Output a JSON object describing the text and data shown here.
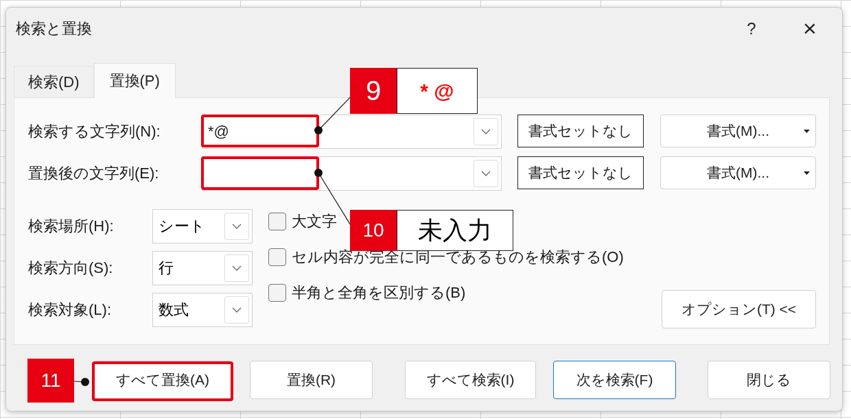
{
  "window": {
    "title": "検索と置換",
    "help": "?",
    "close": "×"
  },
  "tabs": [
    {
      "label": "検索(D)",
      "selected": false
    },
    {
      "label": "置換(P)",
      "selected": true
    }
  ],
  "fields": [
    {
      "label": "検索する文字列(N):",
      "value": "*@",
      "format_preview": "書式セットなし",
      "format_button": "書式(M)..."
    },
    {
      "label": "置換後の文字列(E):",
      "format_preview": "書式セットなし",
      "format_button": "書式(M)..."
    }
  ],
  "selects": [
    {
      "label": "検索場所(H):",
      "value": "シート"
    },
    {
      "label": "検索方向(S):",
      "value": "行"
    },
    {
      "label": "検索対象(L):",
      "value": "数式"
    }
  ],
  "checkboxes": [
    {
      "label": "大文字",
      "checked": false
    },
    {
      "label": "セル内容が完全に同一であるものを検索する(O)",
      "checked": false
    },
    {
      "label": "半角と全角を区別する(B)",
      "checked": false
    }
  ],
  "options_button": "オプション(T) <<",
  "buttons": [
    {
      "label": "すべて置換(A)",
      "default": false
    },
    {
      "label": "置換(R)",
      "default": false
    },
    {
      "label": "すべて検索(I)",
      "default": false
    },
    {
      "label": "次を検索(F)",
      "default": true
    },
    {
      "label": "閉じる",
      "default": false
    }
  ],
  "callouts": [
    {
      "number": "9",
      "text": "* @",
      "color": "#ff0000"
    },
    {
      "number": "10",
      "text": "未入力",
      "color": "#000000"
    },
    {
      "number": "11"
    }
  ]
}
